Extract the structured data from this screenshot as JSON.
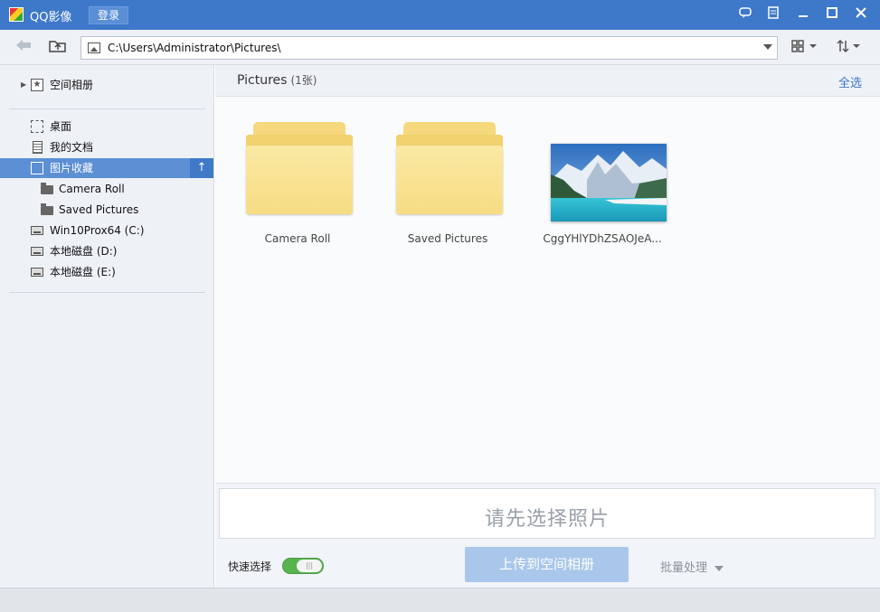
{
  "titlebar": {
    "app_title": "QQ影像",
    "login_label": "登录",
    "icons": [
      "feedback-icon",
      "menu-icon",
      "minimize-icon",
      "maximize-icon",
      "close-icon"
    ]
  },
  "toolbar": {
    "path_value": "C:\\Users\\Administrator\\Pictures\\"
  },
  "sidebar": {
    "qzone_label": "空间相册",
    "items": [
      {
        "label": "桌面"
      },
      {
        "label": "我的文档"
      },
      {
        "label": "图片收藏"
      },
      {
        "label": "Camera Roll"
      },
      {
        "label": "Saved Pictures"
      },
      {
        "label": "Win10Prox64 (C:)"
      },
      {
        "label": "本地磁盘 (D:)"
      },
      {
        "label": "本地磁盘 (E:)"
      }
    ]
  },
  "main": {
    "title": "Pictures",
    "count": "(1张)",
    "select_all": "全选",
    "tiles": [
      {
        "type": "folder",
        "label": "Camera Roll"
      },
      {
        "type": "folder",
        "label": "Saved Pictures"
      },
      {
        "type": "image",
        "label": "CggYHlYDhZSAOJeA..."
      }
    ]
  },
  "bottom": {
    "drop_text": "请先选择照片",
    "quick_select_label": "快速选择",
    "toggle_on": true,
    "upload_label": "上传到空间相册",
    "batch_label": "批量处理"
  },
  "colors": {
    "titlebar": "#3e78c9",
    "active_item": "#5d8fd4",
    "accent": "#3d77c6",
    "toggle": "#59b34e"
  }
}
